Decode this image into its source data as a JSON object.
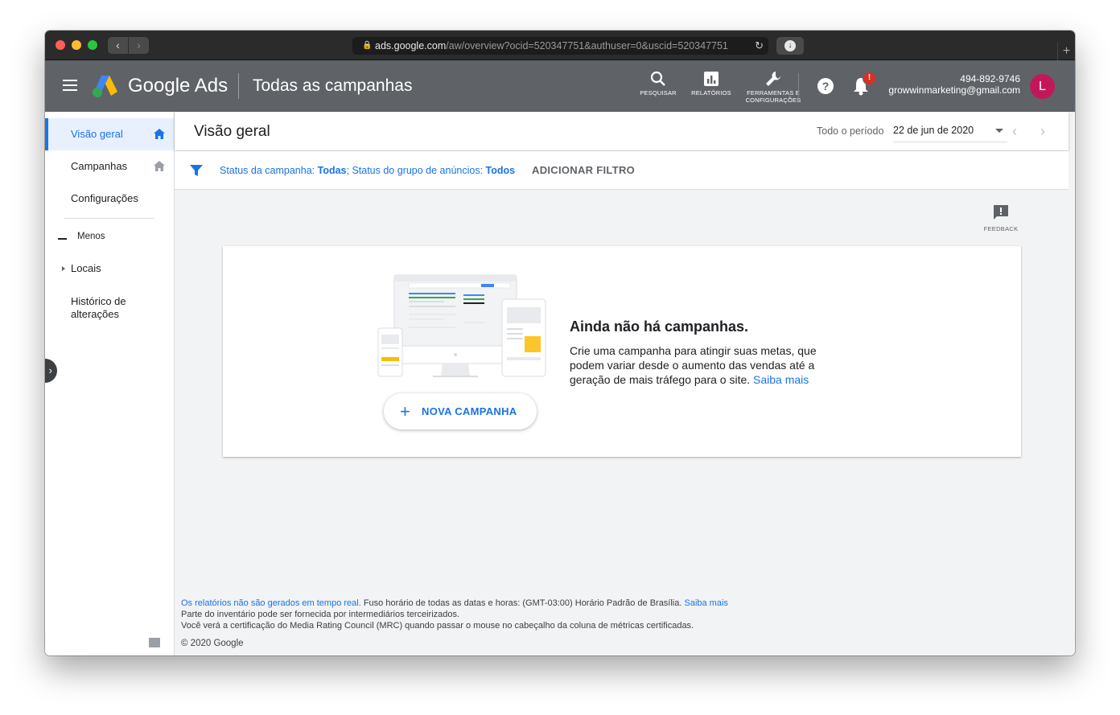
{
  "browser": {
    "url_host": "ads.google.com",
    "url_rest": "/aw/overview?ocid=520347751&authuser=0&uscid=520347751",
    "back_glyph": "‹",
    "forward_glyph": "›",
    "reload_glyph": "↻",
    "newtab_glyph": "+"
  },
  "header": {
    "brand_google": "Google",
    "brand_ads": "Ads",
    "title": "Todas as campanhas",
    "search_label": "PESQUISAR",
    "reports_label": "RELATÓRIOS",
    "tools_label_1": "FERRAMENTAS E",
    "tools_label_2": "CONFIGURAÇÕES",
    "help_glyph": "?",
    "bell_badge": "!",
    "account_phone": "494-892-9746",
    "account_email": "growwinmarketing@gmail.com",
    "avatar_initial": "L"
  },
  "sidebar": {
    "items": [
      {
        "label": "Visão geral"
      },
      {
        "label": "Campanhas"
      },
      {
        "label": "Configurações"
      }
    ],
    "less_label": "Menos",
    "locations_label": "Locais",
    "history_label": "Histórico de alterações",
    "collapse_glyph": "›"
  },
  "main": {
    "page_title": "Visão geral",
    "period_label": "Todo o período",
    "period_value": "22 de jun de 2020",
    "prev_glyph": "‹",
    "next_glyph": "›",
    "filter": {
      "campaign_status_label": "Status da campanha: ",
      "campaign_status_value": "Todas",
      "group_status_label": "; Status do grupo de anúncios: ",
      "group_status_value": "Todos",
      "add_filter": "ADICIONAR FILTRO"
    },
    "feedback_label": "FEEDBACK",
    "empty_state": {
      "title": "Ainda não há campanhas.",
      "description": "Crie uma campanha para atingir suas metas, que podem variar desde o aumento das vendas até a geração de mais tráfego para o site.",
      "learn_more": "Saiba mais",
      "button_plus": "+",
      "button_label": "NOVA CAMPANHA"
    },
    "footer": {
      "line1_link": "Os relatórios não são gerados em tempo real.",
      "line1_text": " Fuso horário de todas as datas e horas: (GMT-03:00) Horário Padrão de Brasília. ",
      "line1_link2": "Saiba mais",
      "line2": "Parte do inventário pode ser fornecida por intermediários terceirizados.",
      "line3": "Você verá a certificação do Media Rating Council (MRC) quando passar o mouse no cabeçalho da coluna de métricas certificadas.",
      "copyright": "© 2020 Google"
    }
  },
  "colors": {
    "header_bg": "#5f6368",
    "accent": "#1a73e8",
    "avatar": "#c2185b",
    "badge": "#d93025"
  }
}
